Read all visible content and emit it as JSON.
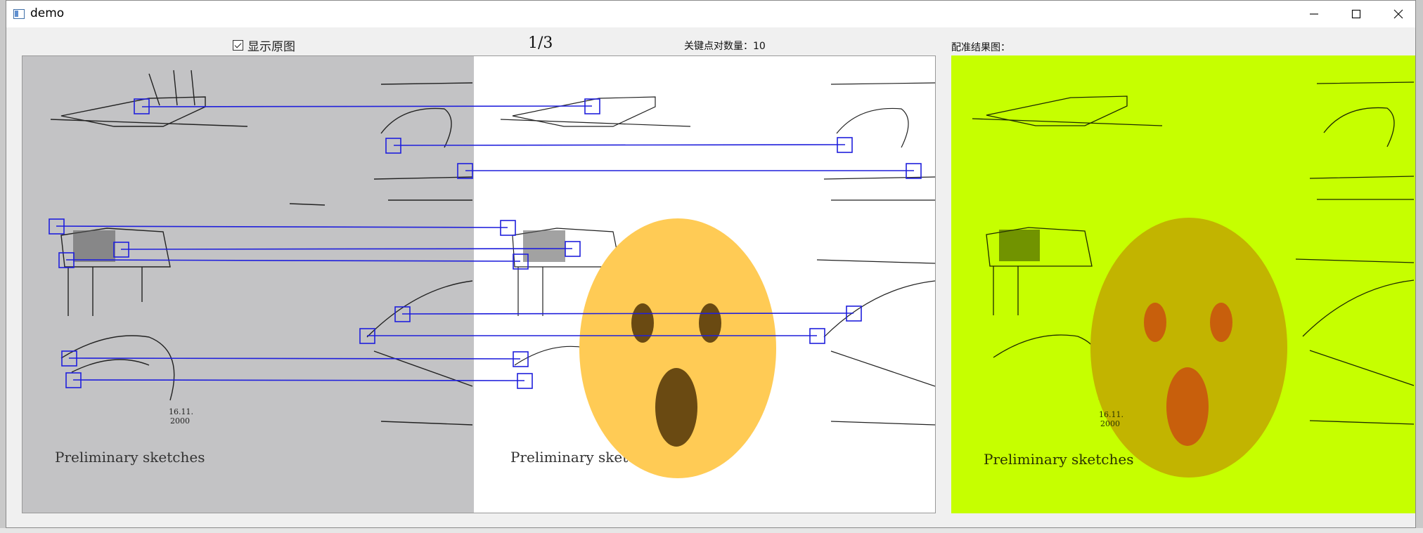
{
  "window": {
    "title": "demo"
  },
  "toolbar": {
    "show_original_label": "显示原图",
    "show_original_checked": true,
    "page_counter": "1/3",
    "keypoint_count_label": "关键点对数量：10"
  },
  "result_panel": {
    "title": "配准结果图："
  },
  "images": {
    "left_caption": "Preliminary sketches",
    "middle_caption": "Preliminary sketches",
    "result_caption": "Preliminary sketches",
    "date_text_line1": "16.11.",
    "date_text_line2": "2000"
  },
  "colors": {
    "match_line": "#1f1fdc",
    "result_background": "#c6ff00",
    "emoji_face": "#ffcb55",
    "emoji_feature": "#6a4a12"
  },
  "icons": [
    "app-icon",
    "minimize-icon",
    "maximize-icon",
    "close-icon",
    "checkbox-checked-icon"
  ],
  "matches_count": 10
}
